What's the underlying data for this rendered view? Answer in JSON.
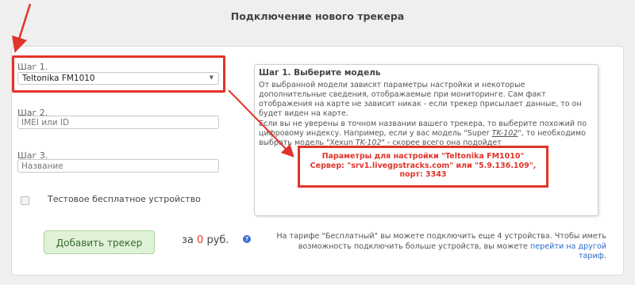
{
  "page": {
    "title": "Подключение нового трекера"
  },
  "form": {
    "step1": {
      "label": "Шаг 1.",
      "selected_model": "Teltonika FM1010"
    },
    "step2": {
      "label": "Шаг 2.",
      "placeholder": "IMEI или ID"
    },
    "step3": {
      "label": "Шаг 3.",
      "placeholder": "Название"
    },
    "test_device": {
      "label": "Тестовое бесплатное устройство",
      "checked": false
    },
    "add_button": "Добавить трекер",
    "price": {
      "prefix": "за",
      "amount": "0",
      "suffix": "руб."
    },
    "help_icon": "question-circle-icon"
  },
  "info": {
    "title": "Шаг 1. Выберите модель",
    "p1": "От выбранной модели зависят параметры настройки и некоторые дополнительные сведения, отображаемые при мониторинге. Сам факт отображения на карте не зависит никак - если трекер присылает данные, то он будет виден на карте.",
    "p2_start": "Если вы не уверены в точном названии вашего трекера, то выберите похожий по цифровому индексу. Например, если у вас модель \"Super ",
    "p2_code1": "TK-102",
    "p2_mid": "\", то необходимо выбрать модель \"Xexun ",
    "p2_code2": "TK-102",
    "p2_end": "\" - скорее всего она подойдет",
    "params_line1": "Параметры для настройки \"Teltonika FM1010\"",
    "params_line2": "Сервер: \"srv1.livegpstracks.com\" или \"5.9.136.109\",",
    "params_line3": "порт: 3343"
  },
  "tariff": {
    "text": "На тарифе \"Бесплатный\" вы можете подключить еще 4 устройства. Чтобы иметь возможность подключить больше устройств, вы можете ",
    "link": "перейти на другой тариф",
    "end": "."
  },
  "colors": {
    "highlight": "#e0342b",
    "button_bg": "#dff2d8",
    "link": "#2a6ac9",
    "price_accent": "#e03b2b"
  }
}
